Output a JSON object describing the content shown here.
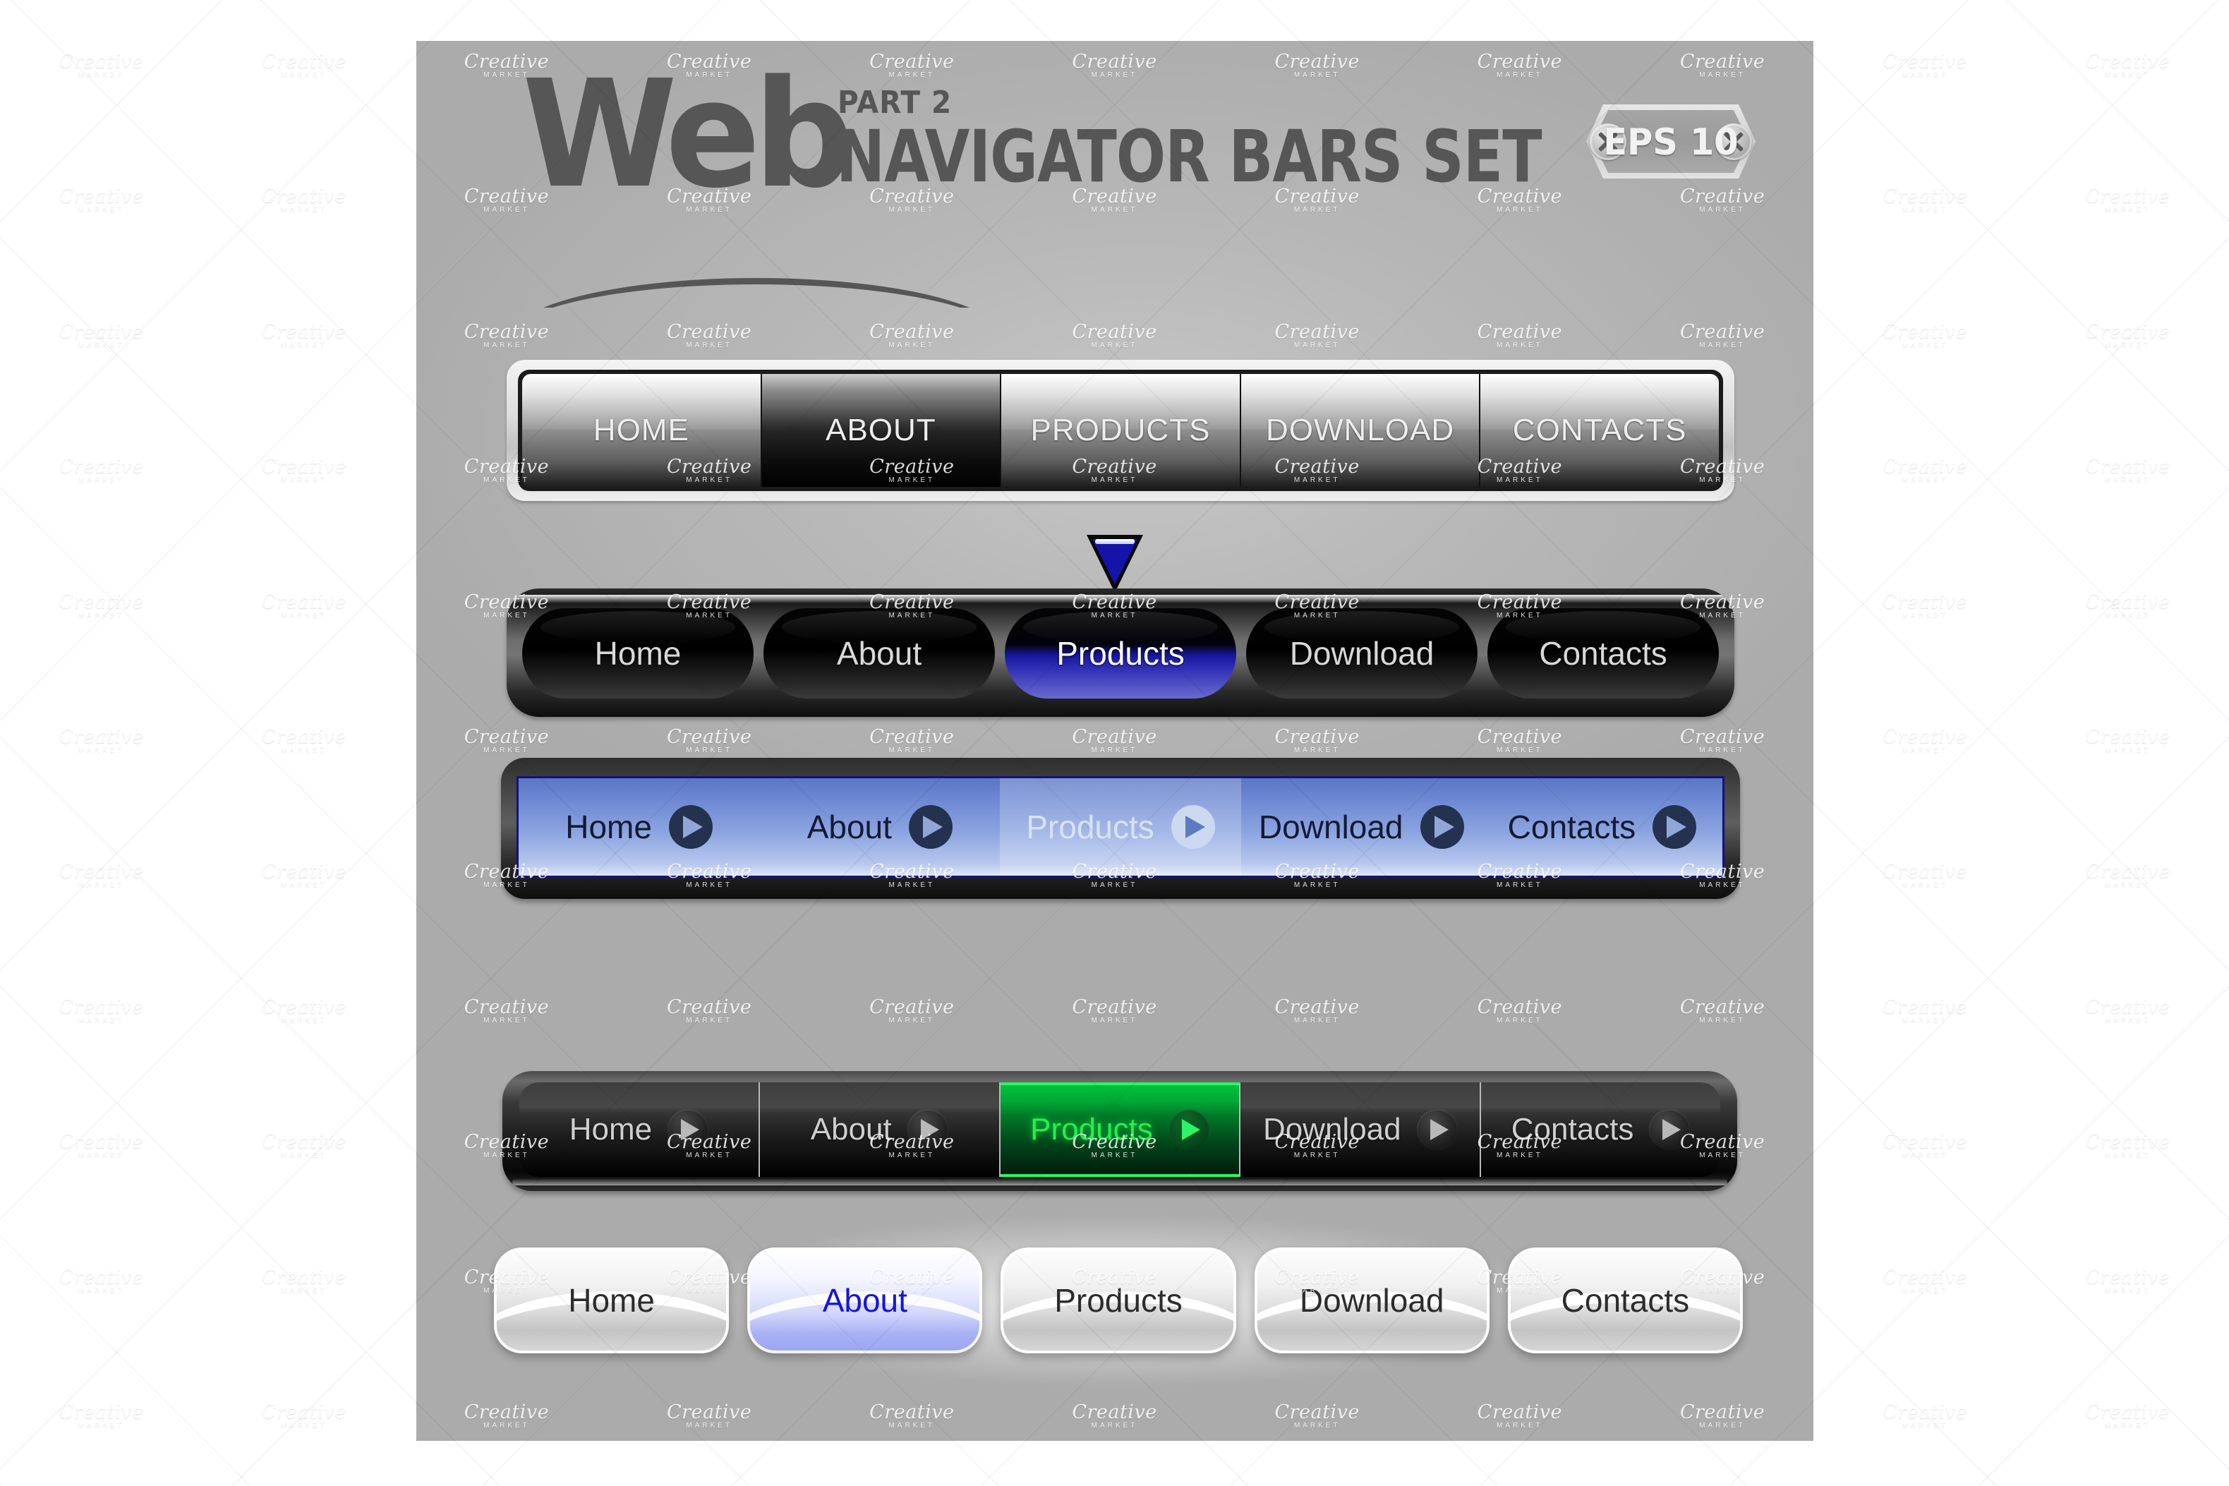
{
  "header": {
    "logo_word": "Web",
    "part_label": "PART 2",
    "title": "NAVIGATOR BARS SET",
    "eps_badge": "EPS 10"
  },
  "bars": [
    {
      "id": "bar-silver-uppercase",
      "style": "silver-metallic",
      "active_index": 1,
      "items": [
        {
          "label": "HOME"
        },
        {
          "label": "ABOUT"
        },
        {
          "label": "PRODUCTS"
        },
        {
          "label": "DOWNLOAD"
        },
        {
          "label": "CONTACTS"
        }
      ]
    },
    {
      "id": "bar-black-pills",
      "style": "black-glossy-pills",
      "active_index": 2,
      "active_color": "#2e2eb4",
      "items": [
        {
          "label": "Home"
        },
        {
          "label": "About"
        },
        {
          "label": "Products"
        },
        {
          "label": "Download"
        },
        {
          "label": "Contacts"
        }
      ]
    },
    {
      "id": "bar-blue-play",
      "style": "blue-gradient-play-icons",
      "active_index": 2,
      "accent_color": "#6f8ad4",
      "items": [
        {
          "label": "Home",
          "icon": "play-circle-icon"
        },
        {
          "label": "About",
          "icon": "play-circle-icon"
        },
        {
          "label": "Products",
          "icon": "play-circle-icon"
        },
        {
          "label": "Download",
          "icon": "play-circle-icon"
        },
        {
          "label": "Contacts",
          "icon": "play-circle-icon"
        }
      ]
    },
    {
      "id": "bar-dark-green-play",
      "style": "dark-with-green-active",
      "active_index": 2,
      "active_color": "#22f24a",
      "items": [
        {
          "label": "Home",
          "icon": "play-circle-icon"
        },
        {
          "label": "About",
          "icon": "play-circle-icon"
        },
        {
          "label": "Products",
          "icon": "play-circle-icon"
        },
        {
          "label": "Download",
          "icon": "play-circle-icon"
        },
        {
          "label": "Contacts",
          "icon": "play-circle-icon"
        }
      ]
    },
    {
      "id": "row-white-rounded",
      "style": "white-rounded-separate",
      "active_index": 1,
      "active_color": "#1414e0",
      "items": [
        {
          "label": "Home"
        },
        {
          "label": "About"
        },
        {
          "label": "Products"
        },
        {
          "label": "Download"
        },
        {
          "label": "Contacts"
        }
      ]
    }
  ],
  "pointer": {
    "name": "down-arrow-indicator",
    "color": "#1414a8"
  },
  "watermark": {
    "brand": "Creative",
    "sub": "MARKET"
  },
  "colors": {
    "canvas_bg": "#b8b8b8",
    "logo_text": "#565656",
    "blue_accent": "#1414a8",
    "green_accent": "#22f24a"
  }
}
